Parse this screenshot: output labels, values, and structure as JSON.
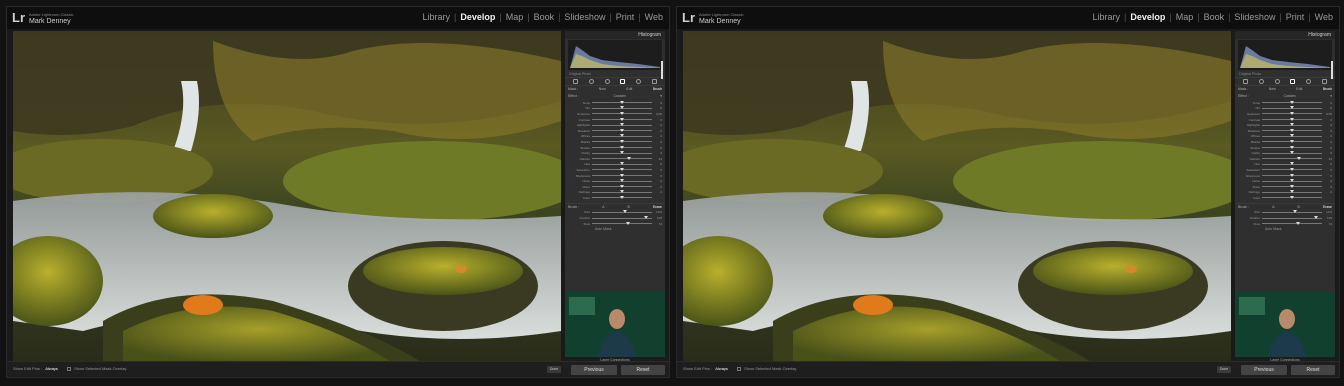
{
  "app": {
    "logo": "Lr",
    "identity_small": "Adobe Lightroom Classic",
    "identity_name": "Mark Denney"
  },
  "modules": [
    "Library",
    "Develop",
    "Map",
    "Book",
    "Slideshow",
    "Print",
    "Web"
  ],
  "active_module": "Develop",
  "right_panel": {
    "histogram_title": "Histogram",
    "original_label": "Original Photo",
    "mask_modes": [
      "Mask :",
      "New",
      "Edit",
      "Brush"
    ],
    "effect_label": "Effect :",
    "effect_value": "Custom",
    "sliders": [
      {
        "label": "Temp",
        "pos": 0.5,
        "value": "0"
      },
      {
        "label": "Tint",
        "pos": 0.5,
        "value": "0"
      },
      {
        "label": "Exposure",
        "pos": 0.5,
        "value": "0.00"
      },
      {
        "label": "Contrast",
        "pos": 0.5,
        "value": "0"
      },
      {
        "label": "Highlights",
        "pos": 0.5,
        "value": "0"
      },
      {
        "label": "Shadows",
        "pos": 0.5,
        "value": "0"
      },
      {
        "label": "Whites",
        "pos": 0.5,
        "value": "0"
      },
      {
        "label": "Blacks",
        "pos": 0.5,
        "value": "0"
      },
      {
        "label": "Texture",
        "pos": 0.5,
        "value": "0"
      },
      {
        "label": "Clarity",
        "pos": 0.5,
        "value": "0"
      },
      {
        "label": "Dehaze",
        "pos": 0.62,
        "value": "23"
      },
      {
        "label": "Hue",
        "pos": 0.5,
        "value": "0"
      },
      {
        "label": "Saturation",
        "pos": 0.5,
        "value": "0"
      },
      {
        "label": "Sharpness",
        "pos": 0.5,
        "value": "0"
      },
      {
        "label": "Noise",
        "pos": 0.5,
        "value": "0"
      },
      {
        "label": "Moire",
        "pos": 0.5,
        "value": "0"
      },
      {
        "label": "Defringe",
        "pos": 0.5,
        "value": "0"
      },
      {
        "label": "Color",
        "pos": 0.5,
        "value": ""
      }
    ],
    "brush_modes": [
      "Brush :",
      "A",
      "B",
      "Erase"
    ],
    "brush_sliders": [
      {
        "label": "Size",
        "pos": 0.55,
        "value": "13.0"
      },
      {
        "label": "Feather",
        "pos": 0.9,
        "value": "100"
      },
      {
        "label": "Flow",
        "pos": 0.6,
        "value": "74"
      }
    ],
    "auto_mask": "Auto Mask",
    "webcam_label": "Layer Connections"
  },
  "bottom_bar": {
    "show_edit_pins": "Show Edit Pins :",
    "edit_pins_mode": "Always",
    "show_overlay": "Show Selected Mask Overlay",
    "done": "Done",
    "previous": "Previous",
    "reset": "Reset"
  }
}
